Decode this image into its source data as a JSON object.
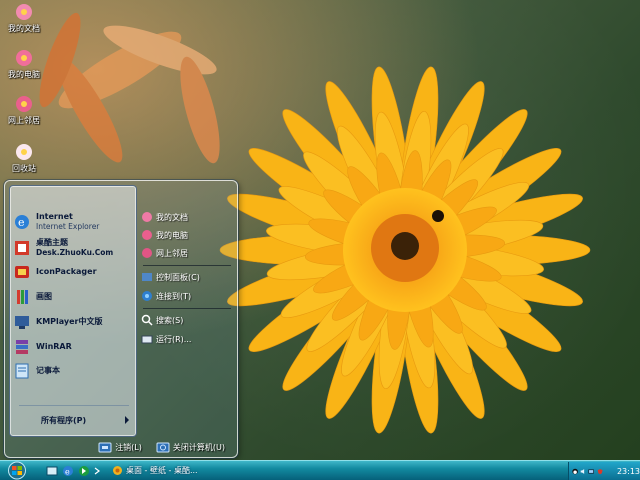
{
  "desktop": {
    "icons": [
      {
        "label": "我的文档",
        "icon": "flower-folder-icon"
      },
      {
        "label": "我的电脑",
        "icon": "flower-computer-icon"
      },
      {
        "label": "网上邻居",
        "icon": "flower-network-icon"
      },
      {
        "label": "回收站",
        "icon": "flower-recycle-bin-icon"
      }
    ]
  },
  "start_menu": {
    "programs": [
      {
        "name": "Internet",
        "sub": "Internet Explorer",
        "icon": "internet-explorer-icon"
      },
      {
        "name": "桌酷主题",
        "sub": "Desk.ZhuoKu.Com",
        "icon": "zhuoku-theme-icon"
      },
      {
        "name": "IconPackager",
        "sub": "",
        "icon": "iconpackager-icon"
      },
      {
        "name": "画图",
        "sub": "",
        "icon": "paint-icon"
      },
      {
        "name": "KMPlayer中文版",
        "sub": "",
        "icon": "kmplayer-icon"
      },
      {
        "name": "WinRAR",
        "sub": "",
        "icon": "winrar-icon"
      },
      {
        "name": "记事本",
        "sub": "",
        "icon": "notepad-icon"
      }
    ],
    "all_programs_label": "所有程序(P)",
    "places": [
      {
        "label": "我的文档",
        "icon": "documents-icon"
      },
      {
        "label": "我的电脑",
        "icon": "computer-icon"
      },
      {
        "label": "网上邻居",
        "icon": "network-icon"
      },
      {
        "label": "控制面板(C)",
        "icon": "control-panel-icon"
      },
      {
        "label": "连接到(T)",
        "icon": "connect-icon"
      },
      {
        "label": "搜索(S)",
        "icon": "search-icon"
      },
      {
        "label": "运行(R)...",
        "icon": "run-icon"
      }
    ],
    "footer": {
      "logoff_label": "注销(L)",
      "shutdown_label": "关闭计算机(U)"
    }
  },
  "taskbar": {
    "start_icon": "windows-orb-icon",
    "quick_launch": [
      "show-desktop-icon",
      "ie-quicklaunch-icon",
      "arrow-quicklaunch-icon"
    ],
    "task_label": "桌面 - 壁纸 - 桌酷...",
    "tray_icons": [
      "qq-icon",
      "volume-icon",
      "network-tray-icon",
      "security-icon"
    ],
    "clock": "23:13"
  },
  "colors": {
    "taskbar": "#128aa0",
    "petal": "#f6b21a",
    "flower_center": "#e08412"
  }
}
